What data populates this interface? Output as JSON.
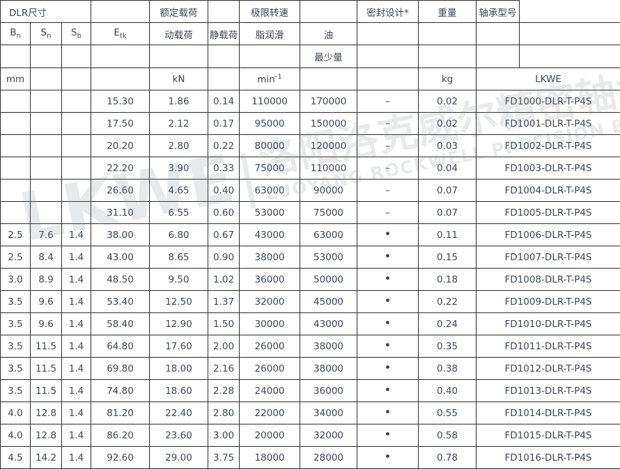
{
  "table": {
    "header": {
      "row1": {
        "dlr_size": "DLR尺寸",
        "rated_load": "额定载荷",
        "limiting_speed": "极限转速",
        "seal_design": "密封设计*",
        "weight": "重量",
        "bearing_model": "轴承型号"
      },
      "row2": {
        "bn": "B",
        "bn_sub": "n",
        "sn": "S",
        "sn_sub": "n",
        "sb": "S",
        "sb_sub": "b",
        "etk": "E",
        "etk_sub": "tk",
        "dynamic_load": "动载荷",
        "static_load": "静载荷",
        "grease": "脂润滑",
        "oil": "油"
      },
      "row3": {
        "minimum": "最少量"
      },
      "row4": {
        "mm": "mm",
        "kn": "kN",
        "rpm": "min",
        "rpm_sup": "-1",
        "kg": "kg",
        "lkwe": "LKWE"
      }
    },
    "symbols": {
      "dash": "–",
      "dot": "•",
      "empty": ""
    },
    "rows": [
      {
        "bn": "",
        "sn": "",
        "sb": "",
        "etk": "15.30",
        "dyn": "1.86",
        "stat": "0.14",
        "grease": "110000",
        "oil": "170000",
        "seal": "–",
        "weight": "0.02",
        "model": "FD1000-DLR-T-P4S"
      },
      {
        "bn": "",
        "sn": "",
        "sb": "",
        "etk": "17.50",
        "dyn": "2.12",
        "stat": "0.17",
        "grease": "95000",
        "oil": "150000",
        "seal": "–",
        "weight": "0.02",
        "model": "FD1001-DLR-T-P4S"
      },
      {
        "bn": "",
        "sn": "",
        "sb": "",
        "etk": "20.20",
        "dyn": "2.80",
        "stat": "0.22",
        "grease": "80000",
        "oil": "120000",
        "seal": "–",
        "weight": "0.03",
        "model": "FD1002-DLR-T-P4S"
      },
      {
        "bn": "",
        "sn": "",
        "sb": "",
        "etk": "22.20",
        "dyn": "3.90",
        "stat": "0.33",
        "grease": "75000",
        "oil": "110000",
        "seal": "–",
        "weight": "0.04",
        "model": "FD1003-DLR-T-P4S"
      },
      {
        "bn": "",
        "sn": "",
        "sb": "",
        "etk": "26.60",
        "dyn": "4.65",
        "stat": "0.40",
        "grease": "63000",
        "oil": "90000",
        "seal": "–",
        "weight": "0.07",
        "model": "FD1004-DLR-T-P4S"
      },
      {
        "bn": "",
        "sn": "",
        "sb": "",
        "etk": "31.10",
        "dyn": "6.55",
        "stat": "0.60",
        "grease": "53000",
        "oil": "75000",
        "seal": "–",
        "weight": "0.07",
        "model": "FD1005-DLR-T-P4S"
      },
      {
        "bn": "2.5",
        "sn": "7.6",
        "sb": "1.4",
        "etk": "38.00",
        "dyn": "6.80",
        "stat": "0.67",
        "grease": "43000",
        "oil": "63000",
        "seal": "•",
        "weight": "0.11",
        "model": "FD1006-DLR-T-P4S"
      },
      {
        "bn": "2.5",
        "sn": "8.4",
        "sb": "1.4",
        "etk": "43.00",
        "dyn": "8.65",
        "stat": "0.90",
        "grease": "38000",
        "oil": "53000",
        "seal": "•",
        "weight": "0.15",
        "model": "FD1007-DLR-T-P4S"
      },
      {
        "bn": "3.0",
        "sn": "8.9",
        "sb": "1.4",
        "etk": "48.50",
        "dyn": "9.50",
        "stat": "1.02",
        "grease": "36000",
        "oil": "50000",
        "seal": "•",
        "weight": "0.18",
        "model": "FD1008-DLR-T-P4S"
      },
      {
        "bn": "3.5",
        "sn": "9.6",
        "sb": "1.4",
        "etk": "53.40",
        "dyn": "12.50",
        "stat": "1.37",
        "grease": "32000",
        "oil": "45000",
        "seal": "•",
        "weight": "0.22",
        "model": "FD1009-DLR-T-P4S"
      },
      {
        "bn": "3.5",
        "sn": "9.6",
        "sb": "1.4",
        "etk": "58.40",
        "dyn": "12.90",
        "stat": "1.50",
        "grease": "30000",
        "oil": "43000",
        "seal": "•",
        "weight": "0.24",
        "model": "FD1010-DLR-T-P4S"
      },
      {
        "bn": "3.5",
        "sn": "11.5",
        "sb": "1.4",
        "etk": "64.80",
        "dyn": "17.60",
        "stat": "2.00",
        "grease": "26000",
        "oil": "38000",
        "seal": "•",
        "weight": "0.35",
        "model": "FD1011-DLR-T-P4S"
      },
      {
        "bn": "3.5",
        "sn": "11.5",
        "sb": "1.4",
        "etk": "69.80",
        "dyn": "18.00",
        "stat": "2.16",
        "grease": "26000",
        "oil": "38000",
        "seal": "•",
        "weight": "0.38",
        "model": "FD1012-DLR-T-P4S"
      },
      {
        "bn": "3.5",
        "sn": "11.5",
        "sb": "1.4",
        "etk": "74.80",
        "dyn": "18.60",
        "stat": "2.28",
        "grease": "24000",
        "oil": "36000",
        "seal": "•",
        "weight": "0.40",
        "model": "FD1013-DLR-T-P4S"
      },
      {
        "bn": "4.0",
        "sn": "12.8",
        "sb": "1.4",
        "etk": "81.20",
        "dyn": "22.40",
        "stat": "2.80",
        "grease": "22000",
        "oil": "34000",
        "seal": "•",
        "weight": "0.55",
        "model": "FD1014-DLR-T-P4S"
      },
      {
        "bn": "4.0",
        "sn": "12.8",
        "sb": "1.4",
        "etk": "86.20",
        "dyn": "23.60",
        "stat": "3.00",
        "grease": "20000",
        "oil": "32000",
        "seal": "•",
        "weight": "0.58",
        "model": "FD1015-DLR-T-P4S"
      },
      {
        "bn": "4.5",
        "sn": "14.2",
        "sb": "1.4",
        "etk": "92.60",
        "dyn": "29.00",
        "stat": "3.75",
        "grease": "18000",
        "oil": "28000",
        "seal": "•",
        "weight": "0.78",
        "model": "FD1016-DLR-T-P4S"
      }
    ]
  },
  "watermark": {
    "mark": "LKWE",
    "bar": "|",
    "company_cn": "洛阳洛克威尔精密轴承有限公司",
    "company_en": "LUOYANG ROCKWELL PRECISION BEARING CO., LTD."
  }
}
